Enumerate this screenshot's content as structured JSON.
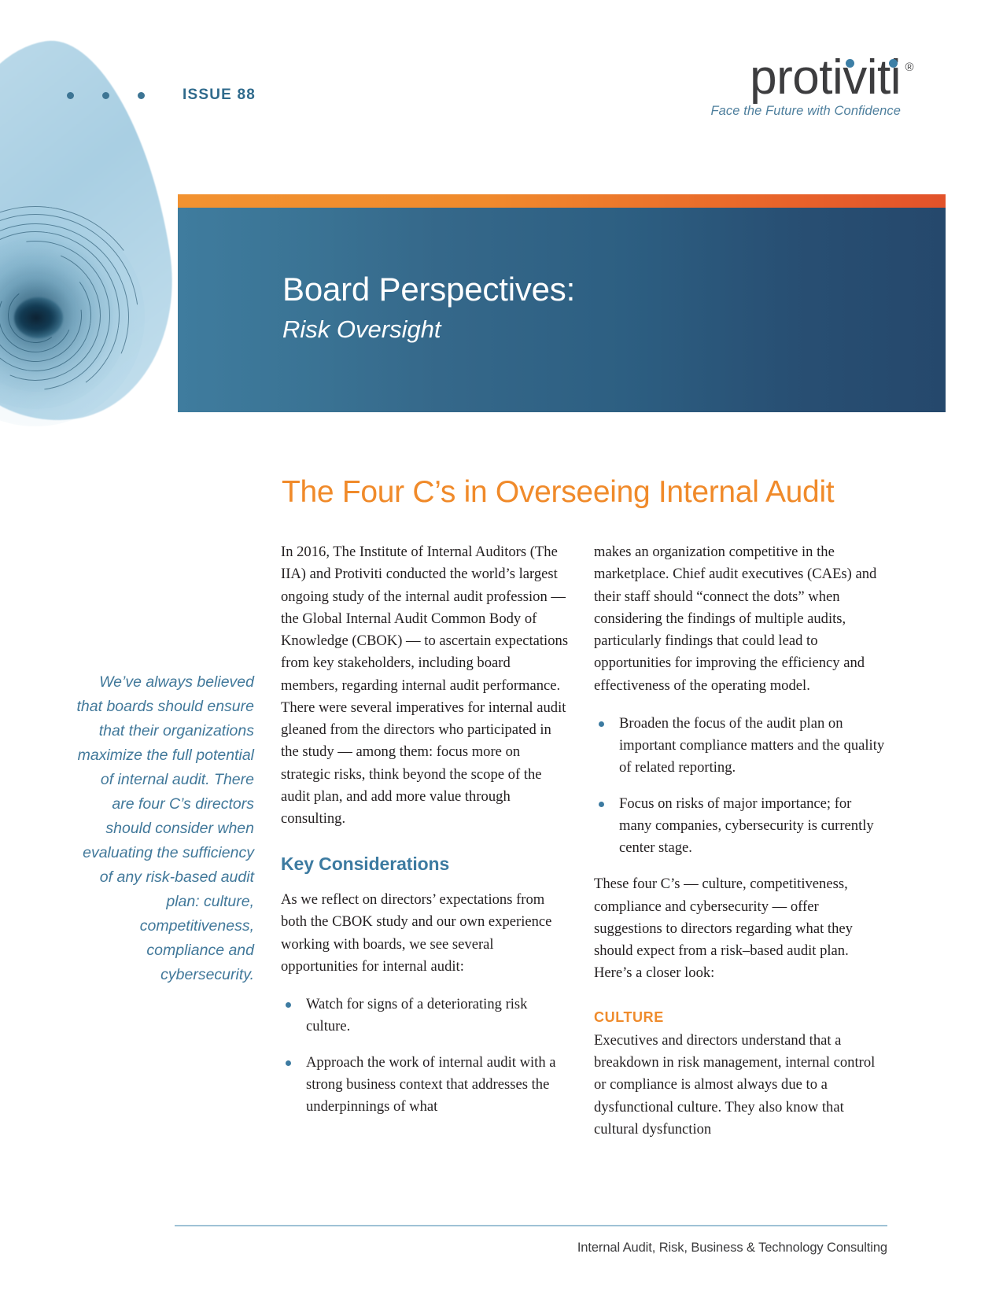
{
  "header": {
    "issue_label": "ISSUE 88",
    "dots_count": 3,
    "logo_word": "protiviti",
    "logo_registered": "®",
    "logo_tagline": "Face the Future with Confidence"
  },
  "banner": {
    "title": "Board Perspectives:",
    "subtitle": "Risk Oversight",
    "accent_top": "#f08a2c",
    "accent_top_end": "#e2522a",
    "bg_start": "#3f7c9e",
    "bg_end": "#25486c"
  },
  "article": {
    "headline": "The Four C’s in Overseeing Internal Audit",
    "headline_color": "#f08a2a"
  },
  "pullquote": {
    "text": "We’ve always believed that boards should ensure that their organizations maximize the full potential of internal audit. There are four C’s directors should consider when evaluating the sufficiency of any risk-based audit plan: culture, competitiveness, compliance and cybersecurity.",
    "color": "#41789a"
  },
  "column1": {
    "intro_paragraph": "In 2016, The Institute of Internal Auditors (The IIA) and Protiviti conducted the world’s largest ongoing study of the internal audit profession — the Global Internal Audit Common Body of Knowledge (CBOK) — to ascertain expectations from key stakeholders, including board members, regarding internal audit performance. There were several imperatives for internal audit gleaned from the directors who participated in the study — among them: focus more on strategic risks, think beyond the scope of the audit plan, and add more value through consulting.",
    "section_heading": "Key Considerations",
    "section_heading_color": "#3d7ba1",
    "lead_paragraph": "As we reflect on directors’ expectations from both the CBOK study and our own experience working with boards, we see several opportunities for internal audit:",
    "bullets": [
      "Watch for signs of a deteriorating risk culture.",
      "Approach the work of internal audit with a strong business context that addresses the underpinnings of what"
    ]
  },
  "column2": {
    "continued_paragraph": "makes an organization competitive in the marketplace. Chief audit executives (CAEs) and their staff should “connect the dots” when considering the findings of multiple audits, particularly findings that could lead to opportunities for improving the efficiency and effectiveness of the operating model.",
    "bullets": [
      "Broaden the focus of the audit plan on important compliance matters and the quality of related reporting.",
      "Focus on risks of major importance; for many companies, cybersecurity is currently center stage."
    ],
    "closing_paragraph": "These four C’s — culture, competitiveness, compliance and cybersecurity — offer suggestions to directors regarding what they should expect from a risk–based audit plan. Here’s a closer look:",
    "subsection_heading": "CULTURE",
    "subsection_heading_color": "#ef8b2c",
    "subsection_paragraph": "Executives and directors understand that a breakdown in risk management, internal control or compliance is almost always due to a dysfunctional culture. They also know that cultural dysfunction"
  },
  "footer": {
    "text": "Internal Audit, Risk, Business & Technology Consulting",
    "rule_color": "#9fc2d6"
  }
}
